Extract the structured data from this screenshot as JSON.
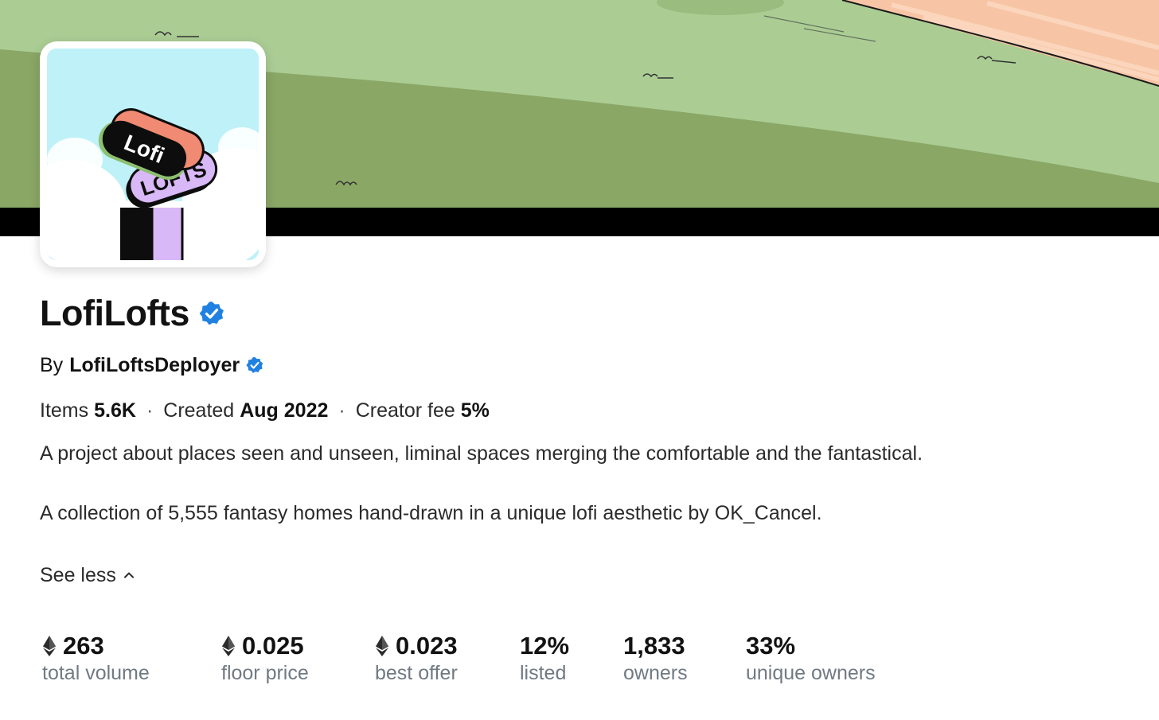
{
  "collection": {
    "name": "LofiLofts",
    "verified_icon": "verified-badge-icon",
    "avatar_logo_text": [
      "Lofi",
      "LOFTS"
    ]
  },
  "creator": {
    "prefix": "By",
    "name": "LofiLoftsDeployer",
    "verified_icon": "verified-badge-icon"
  },
  "meta": {
    "items_label": "Items",
    "items_value": "5.6K",
    "created_label": "Created",
    "created_value": "Aug 2022",
    "fee_label": "Creator fee",
    "fee_value": "5%",
    "separator": "·"
  },
  "description": {
    "paragraph_1": "A project about places seen and unseen, liminal spaces merging the comfortable and the fantastical.",
    "paragraph_2": "A collection of 5,555 fantasy homes hand-drawn in a unique lofi aesthetic by OK_Cancel."
  },
  "toggle": {
    "label": "See less",
    "icon": "chevron-up-icon"
  },
  "stats": [
    {
      "value": "263",
      "label": "total volume",
      "eth": true
    },
    {
      "value": "0.025",
      "label": "floor price",
      "eth": true
    },
    {
      "value": "0.023",
      "label": "best offer",
      "eth": true
    },
    {
      "value": "12%",
      "label": "listed",
      "eth": false
    },
    {
      "value": "1,833",
      "label": "owners",
      "eth": false
    },
    {
      "value": "33%",
      "label": "unique owners",
      "eth": false
    }
  ],
  "colors": {
    "verified": "#2081e2",
    "banner_grass_light": "#abcd94",
    "banner_grass_dark": "#8aa766",
    "banner_sky": "#f7c5a6",
    "secondary_text": "#707a83"
  }
}
